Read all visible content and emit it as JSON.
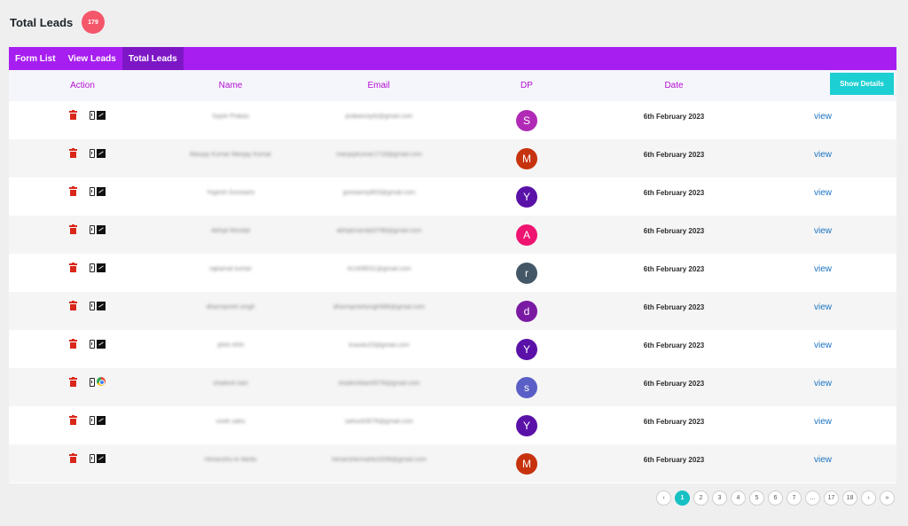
{
  "header": {
    "title": "Total Leads",
    "count": "179"
  },
  "tabs": [
    {
      "label": "Form List",
      "active": false
    },
    {
      "label": "View Leads",
      "active": false
    },
    {
      "label": "Total Leads",
      "active": true
    }
  ],
  "columns": {
    "action": "Action",
    "name": "Name",
    "email": "Email",
    "dp": "DP",
    "date": "Date"
  },
  "show_details_label": "Show Details",
  "rows": [
    {
      "name": "Sayte Prakas",
      "email": "prabasrayte@gmail.com",
      "dp": "S",
      "dp_color": "#b02ab6",
      "date": "6th February 2023",
      "link": "view",
      "browser": "generic"
    },
    {
      "name": "Manjay Kumar Manjay Kumar",
      "email": "manjaykumar1718@gmail.com",
      "dp": "M",
      "dp_color": "#c7330e",
      "date": "6th February 2023",
      "link": "view",
      "browser": "generic"
    },
    {
      "name": "Yogesh Goswami",
      "email": "goswamiy803@gmail.com",
      "dp": "Y",
      "dp_color": "#5a11a8",
      "date": "6th February 2023",
      "link": "view",
      "browser": "generic"
    },
    {
      "name": "Abhijit Mondal",
      "email": "abhijitmandal3786@gmail.com",
      "dp": "A",
      "dp_color": "#ee1470",
      "date": "6th February 2023",
      "link": "view",
      "browser": "generic"
    },
    {
      "name": "rajkamal kumar",
      "email": "rk1408531@gmail.com",
      "dp": "r",
      "dp_color": "#435766",
      "date": "6th February 2023",
      "link": "view",
      "browser": "generic"
    },
    {
      "name": "dharmpreet singh",
      "email": "dharmpreetsingh986@gmail.com",
      "dp": "d",
      "dp_color": "#7a1aa3",
      "date": "6th February 2023",
      "link": "view",
      "browser": "generic"
    },
    {
      "name": "ijhhh ihhh",
      "email": "kraudu23@gmail.com",
      "dp": "Y",
      "dp_color": "#5a11a8",
      "date": "6th February 2023",
      "link": "view",
      "browser": "generic"
    },
    {
      "name": "shailesh bari",
      "email": "shaileshbari0078@gmail.com",
      "dp": "s",
      "dp_color": "#5a5fc7",
      "date": "6th February 2023",
      "link": "view",
      "browser": "chrome"
    },
    {
      "name": "vivek sahu",
      "email": "sahuv63078@gmail.com",
      "dp": "Y",
      "dp_color": "#5a11a8",
      "date": "6th February 2023",
      "link": "view",
      "browser": "generic"
    },
    {
      "name": "Himanshu kr Aledu",
      "email": "himanshkrmahto3339@gmail.com",
      "dp": "M",
      "dp_color": "#c7330e",
      "date": "6th February 2023",
      "link": "view",
      "browser": "generic"
    }
  ],
  "pagination": {
    "prev": "‹",
    "pages": [
      "1",
      "2",
      "3",
      "4",
      "5",
      "6",
      "7",
      "...",
      "17",
      "18"
    ],
    "current": "1",
    "next": "›",
    "last": "»"
  },
  "icons": {
    "delete": "trash-icon",
    "device": "mobile-phone-icon",
    "browser": "browser-icon"
  },
  "colors": {
    "accent": "#a71ef0",
    "active_tab": "#7d17c6",
    "header_text": "#b40fd3",
    "button": "#1bcfd3",
    "badge": "#f4566a",
    "link": "#1a73c1",
    "delete": "#d9281b"
  }
}
